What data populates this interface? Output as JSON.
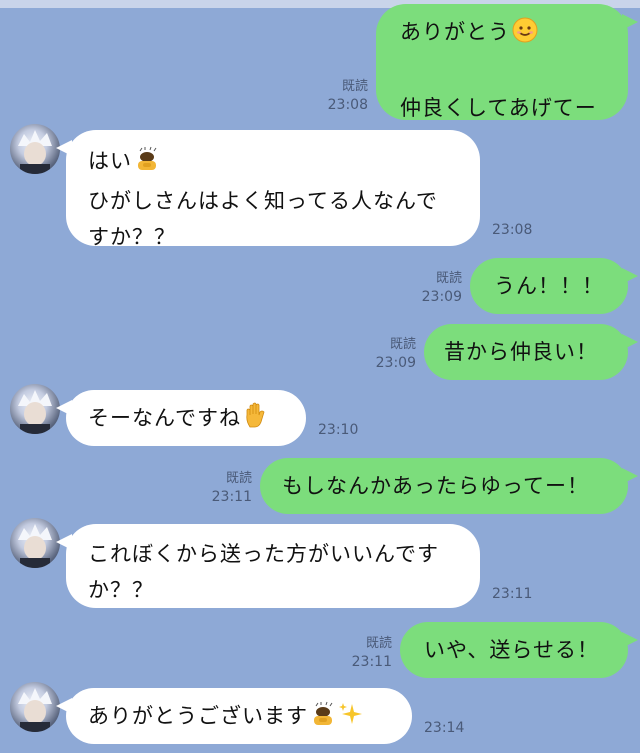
{
  "messages": [
    {
      "side": "out",
      "lines": [
        "ありがとう",
        "",
        "仲良くしてあげてー"
      ],
      "read": "既読",
      "time": "23:08",
      "emoji": "smile-emoji"
    },
    {
      "side": "in",
      "lines": [
        "はい",
        "ひがしさんはよく知ってる人なんで",
        "すか？？"
      ],
      "time": "23:08",
      "emoji": "bowing-person-emoji"
    },
    {
      "side": "out",
      "lines": [
        "うん！！！"
      ],
      "read": "既読",
      "time": "23:09"
    },
    {
      "side": "out",
      "lines": [
        "昔から仲良い！"
      ],
      "read": "既読",
      "time": "23:09"
    },
    {
      "side": "in",
      "lines": [
        "そーなんですね"
      ],
      "time": "23:10",
      "emoji": "raised-hand-emoji"
    },
    {
      "side": "out",
      "lines": [
        "もしなんかあったらゆってー！"
      ],
      "read": "既読",
      "time": "23:11"
    },
    {
      "side": "in",
      "lines": [
        "これぼくから送った方がいいんです",
        "か？？"
      ],
      "time": "23:11"
    },
    {
      "side": "out",
      "lines": [
        "いや、送らせる！"
      ],
      "read": "既読",
      "time": "23:11"
    },
    {
      "side": "in",
      "lines": [
        "ありがとうございます"
      ],
      "time": "23:14",
      "emoji": "bowing-person-emoji sparkles-emoji"
    }
  ]
}
